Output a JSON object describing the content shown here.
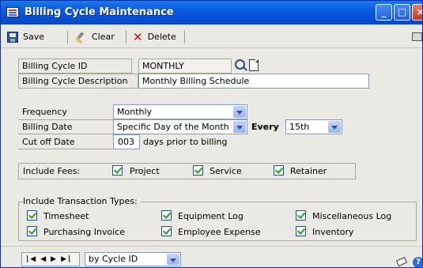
{
  "window": {
    "title": "Billing Cycle Maintenance"
  },
  "toolbar": {
    "save_label": "Save",
    "clear_label": "Clear",
    "delete_label": "Delete"
  },
  "form": {
    "billing_cycle_id_label": "Billing Cycle ID",
    "billing_cycle_id_value": "MONTHLY",
    "description_label": "Billing Cycle Description",
    "description_value": "Monthly Billing Schedule",
    "frequency_label": "Frequency",
    "frequency_value": "Monthly",
    "billing_date_label": "Billing Date",
    "billing_date_value": "Specific Day of the Month",
    "every_label": "Every",
    "every_value": "15th",
    "cutoff_label": "Cut off Date",
    "cutoff_value": "003",
    "cutoff_suffix": "days prior to billing"
  },
  "include_fees": {
    "label": "Include Fees:",
    "items": [
      {
        "label": "Project",
        "checked": true
      },
      {
        "label": "Service",
        "checked": true
      },
      {
        "label": "Retainer",
        "checked": true
      }
    ]
  },
  "transaction_types": {
    "label": "Include Transaction Types:",
    "items": [
      {
        "label": "Timesheet",
        "checked": true
      },
      {
        "label": "Equipment Log",
        "checked": true
      },
      {
        "label": "Miscellaneous Log",
        "checked": true
      },
      {
        "label": "Purchasing Invoice",
        "checked": true
      },
      {
        "label": "Employee Expense",
        "checked": true
      },
      {
        "label": "Inventory",
        "checked": true
      }
    ]
  },
  "navigation": {
    "sort_value": "by Cycle ID"
  },
  "icons": {
    "window": "window-icon",
    "save": "save-icon",
    "clear": "clear-icon",
    "delete": "delete-icon",
    "print": "print-icon",
    "lookup": "lookup-icon",
    "note": "note-icon",
    "eraser": "eraser-icon",
    "help": "help-icon"
  },
  "colors": {
    "titlebar": "#0550d8",
    "window_bg": "#ebe9e4",
    "check": "#21a121",
    "delete": "#c21010"
  }
}
